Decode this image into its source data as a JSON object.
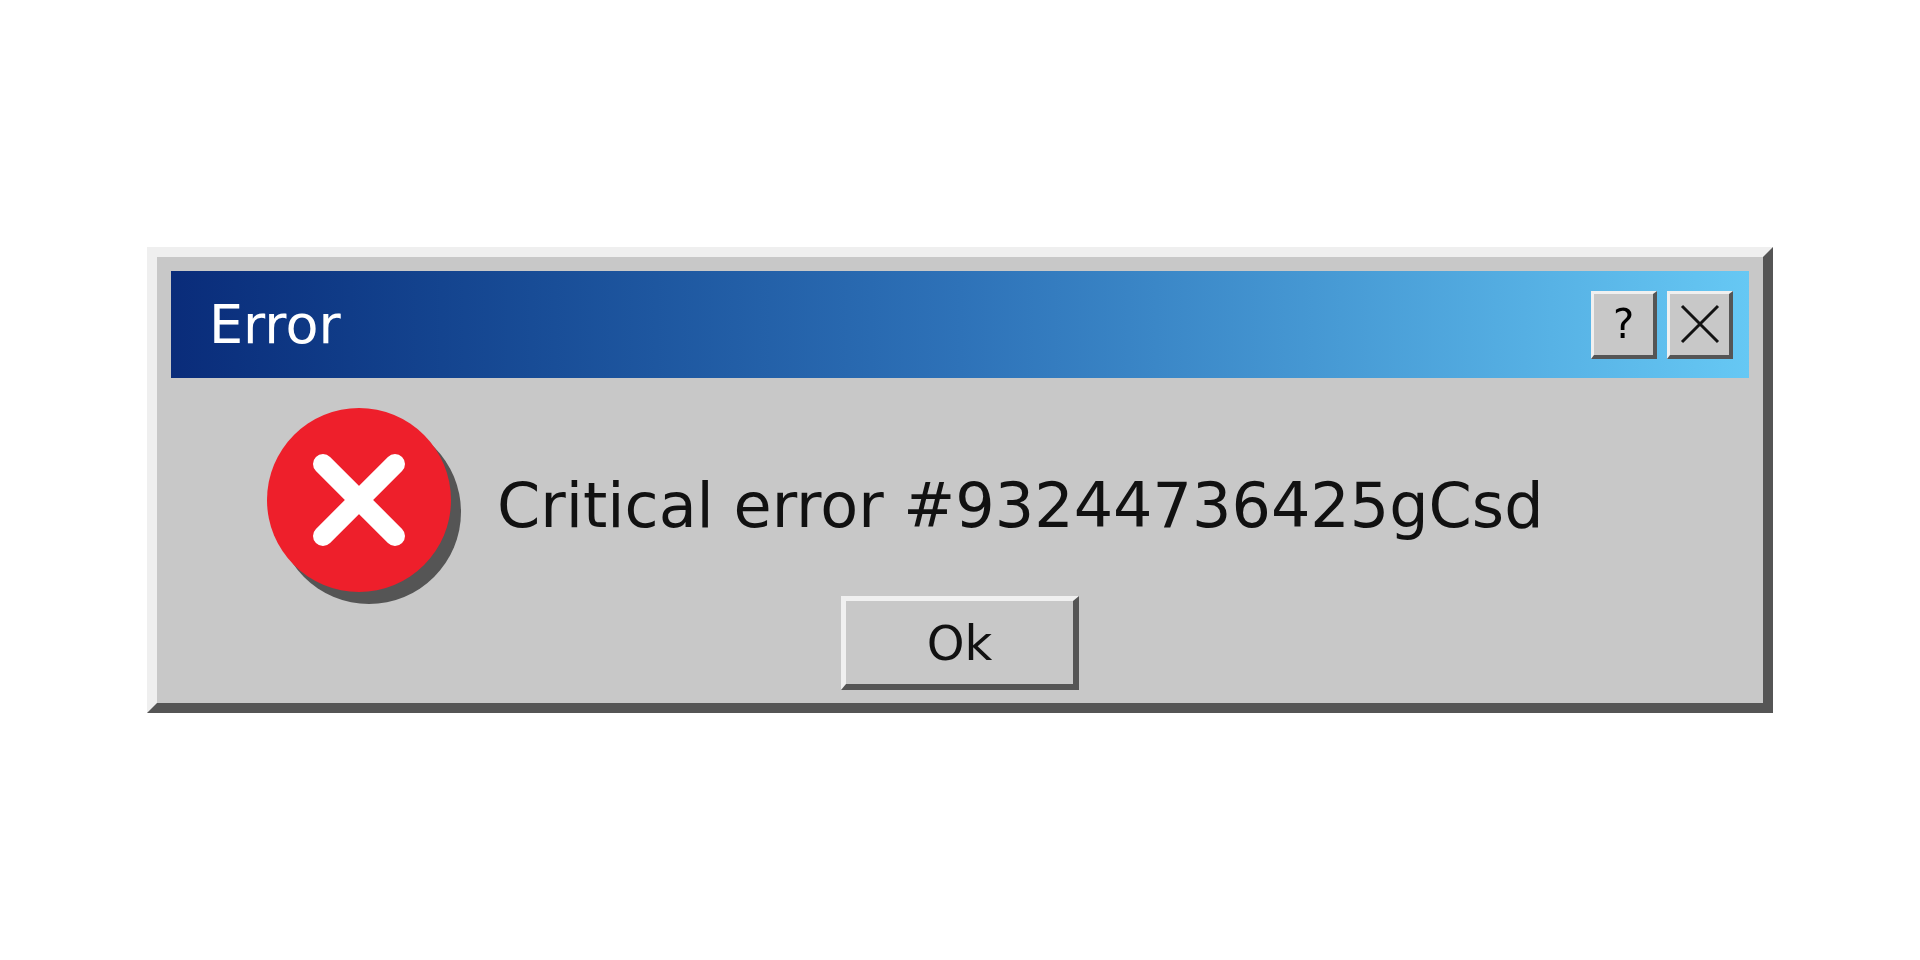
{
  "window": {
    "title": "Error",
    "help_button": {
      "label": "?"
    }
  },
  "message": "Critical error #93244736425gCsd",
  "buttons": [
    {
      "label": "Ok"
    }
  ]
}
